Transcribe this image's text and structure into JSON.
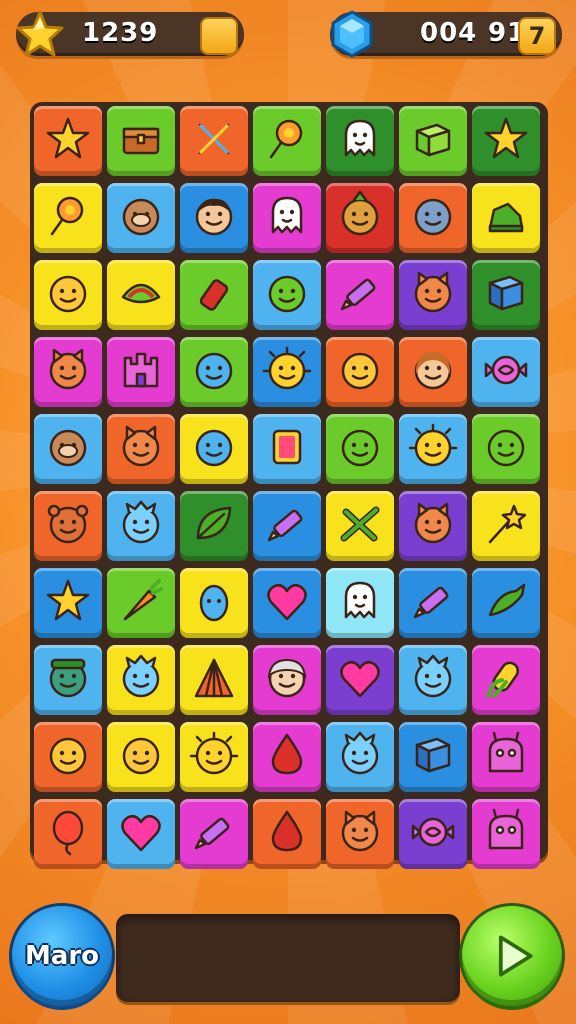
{
  "hud": {
    "score_value": "1239",
    "gem_value": "004",
    "gem_extra": "91",
    "level_badge": "7",
    "left_badge": "",
    "colors": {
      "panel": "#4a3526",
      "badge": "#f3a715"
    }
  },
  "board": {
    "rows": [
      [
        {
          "color": "#f0652a",
          "icon": "star"
        },
        {
          "color": "#6bcb2a",
          "icon": "chest"
        },
        {
          "color": "#f0652a",
          "icon": "tools"
        },
        {
          "color": "#6bcb2a",
          "icon": "lollipop"
        },
        {
          "color": "#2f8f2a",
          "icon": "ghost"
        },
        {
          "color": "#6bcb2a",
          "icon": "box"
        },
        {
          "color": "#2f8f2a",
          "icon": "star"
        }
      ],
      [
        {
          "color": "#f7e21b",
          "icon": "lollipop"
        },
        {
          "color": "#4fb3f0",
          "icon": "monkey-face"
        },
        {
          "color": "#2a8fe0",
          "icon": "boy-face"
        },
        {
          "color": "#e43bd0",
          "icon": "ghost"
        },
        {
          "color": "#d9302a",
          "icon": "pineapple-face"
        },
        {
          "color": "#f0652a",
          "icon": "balloon-face"
        },
        {
          "color": "#f7e21b",
          "icon": "boot"
        }
      ],
      [
        {
          "color": "#f7e21b",
          "icon": "smile-face"
        },
        {
          "color": "#f7e21b",
          "icon": "melon"
        },
        {
          "color": "#6bcb2a",
          "icon": "bottle"
        },
        {
          "color": "#4fb3f0",
          "icon": "blob-face"
        },
        {
          "color": "#e43bd0",
          "icon": "crayon"
        },
        {
          "color": "#7a3fd0",
          "icon": "cat-face"
        },
        {
          "color": "#2f8f2a",
          "icon": "cube"
        }
      ],
      [
        {
          "color": "#e43bd0",
          "icon": "cat-face"
        },
        {
          "color": "#e43bd0",
          "icon": "castle"
        },
        {
          "color": "#6bcb2a",
          "icon": "alien-face"
        },
        {
          "color": "#2a8fe0",
          "icon": "sun-face"
        },
        {
          "color": "#f0652a",
          "icon": "smile-face"
        },
        {
          "color": "#f0652a",
          "icon": "girl-face"
        },
        {
          "color": "#4fb3f0",
          "icon": "candy"
        }
      ],
      [
        {
          "color": "#4fb3f0",
          "icon": "monkey-face"
        },
        {
          "color": "#f0652a",
          "icon": "cat-face"
        },
        {
          "color": "#f7e21b",
          "icon": "alien-face"
        },
        {
          "color": "#4fb3f0",
          "icon": "card"
        },
        {
          "color": "#6bcb2a",
          "icon": "blob-face"
        },
        {
          "color": "#4fb3f0",
          "icon": "sun-face"
        },
        {
          "color": "#6bcb2a",
          "icon": "chat-face"
        }
      ],
      [
        {
          "color": "#f0652a",
          "icon": "bear-face"
        },
        {
          "color": "#4fb3f0",
          "icon": "spiky-face"
        },
        {
          "color": "#2f8f2a",
          "icon": "leaf"
        },
        {
          "color": "#2a8fe0",
          "icon": "crayon"
        },
        {
          "color": "#f7e21b",
          "icon": "leaf-cross"
        },
        {
          "color": "#7a3fd0",
          "icon": "cat-face"
        },
        {
          "color": "#f7e21b",
          "icon": "wand"
        }
      ],
      [
        {
          "color": "#2a8fe0",
          "icon": "star"
        },
        {
          "color": "#6bcb2a",
          "icon": "carrot"
        },
        {
          "color": "#f7e21b",
          "icon": "egg"
        },
        {
          "color": "#2a8fe0",
          "icon": "heart"
        },
        {
          "color": "#8fe6f7",
          "icon": "ghost"
        },
        {
          "color": "#2a8fe0",
          "icon": "crayon"
        },
        {
          "color": "#2a8fe0",
          "icon": "bird"
        }
      ],
      [
        {
          "color": "#4fb3f0",
          "icon": "zombie-face"
        },
        {
          "color": "#f7e21b",
          "icon": "spiky-face"
        },
        {
          "color": "#f7e21b",
          "icon": "tent"
        },
        {
          "color": "#e43bd0",
          "icon": "old-face"
        },
        {
          "color": "#7a3fd0",
          "icon": "heart"
        },
        {
          "color": "#4fb3f0",
          "icon": "spiky-face"
        },
        {
          "color": "#e43bd0",
          "icon": "corn"
        }
      ],
      [
        {
          "color": "#f0652a",
          "icon": "smile-face"
        },
        {
          "color": "#f7e21b",
          "icon": "smile-face"
        },
        {
          "color": "#f7e21b",
          "icon": "sun-face"
        },
        {
          "color": "#e43bd0",
          "icon": "drop"
        },
        {
          "color": "#4fb3f0",
          "icon": "spiky-face"
        },
        {
          "color": "#2a8fe0",
          "icon": "cube"
        },
        {
          "color": "#e43bd0",
          "icon": "monster"
        }
      ],
      [
        {
          "color": "#f0652a",
          "icon": "balloon"
        },
        {
          "color": "#4fb3f0",
          "icon": "heart"
        },
        {
          "color": "#e43bd0",
          "icon": "crayon"
        },
        {
          "color": "#f0652a",
          "icon": "drop"
        },
        {
          "color": "#f0652a",
          "icon": "cat-face"
        },
        {
          "color": "#7a3fd0",
          "icon": "candy"
        },
        {
          "color": "#e43bd0",
          "icon": "monster"
        }
      ]
    ]
  },
  "controls": {
    "left_label": "Maro",
    "play_icon": "play-icon"
  }
}
